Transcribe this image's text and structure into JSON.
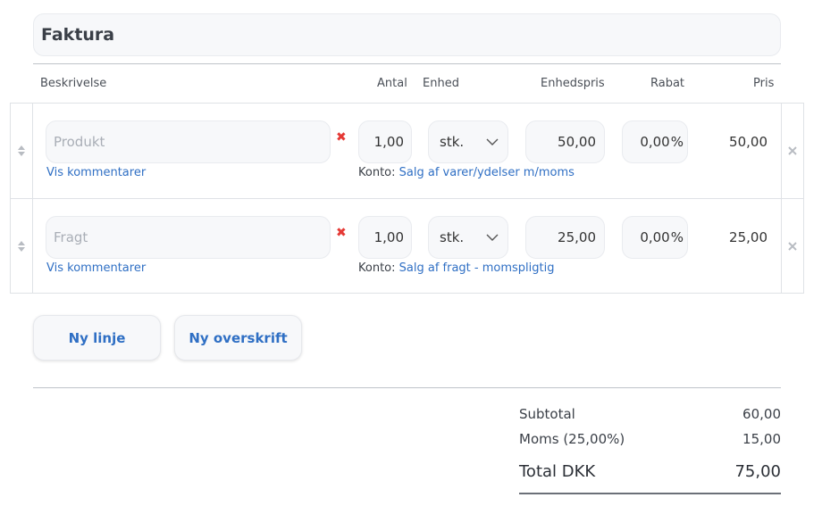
{
  "invoice": {
    "title": "Faktura"
  },
  "columns": {
    "description": "Beskrivelse",
    "quantity": "Antal",
    "unit": "Enhed",
    "unit_price": "Enhedspris",
    "discount": "Rabat",
    "price": "Pris"
  },
  "lines": [
    {
      "description_placeholder": "Produkt",
      "quantity": "1,00",
      "unit": "stk.",
      "unit_price": "50,00",
      "discount": "0,00",
      "discount_suffix": "%",
      "price": "50,00",
      "comments_link": "Vis kommentarer",
      "account_label": "Konto:",
      "account_name": "Salg af varer/ydelser m/moms"
    },
    {
      "description_placeholder": "Fragt",
      "quantity": "1,00",
      "unit": "stk.",
      "unit_price": "25,00",
      "discount": "0,00",
      "discount_suffix": "%",
      "price": "25,00",
      "comments_link": "Vis kommentarer",
      "account_label": "Konto:",
      "account_name": "Salg af fragt - momspligtig"
    }
  ],
  "actions": {
    "new_line": "Ny linje",
    "new_heading": "Ny overskrift"
  },
  "summary": {
    "subtotal_label": "Subtotal",
    "subtotal_value": "60,00",
    "vat_label": "Moms (25,00%)",
    "vat_value": "15,00",
    "total_label": "Total DKK",
    "total_value": "75,00"
  },
  "colors": {
    "link": "#2f6fc4",
    "remove_red": "#e53935"
  }
}
